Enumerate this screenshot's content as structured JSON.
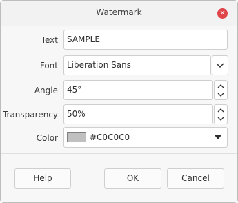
{
  "window": {
    "title": "Watermark"
  },
  "form": {
    "text": {
      "label": "Text",
      "value": "SAMPLE"
    },
    "font": {
      "label": "Font",
      "value": "Liberation Sans"
    },
    "angle": {
      "label": "Angle",
      "value": "45°"
    },
    "transparency": {
      "label": "Transparency",
      "value": "50%"
    },
    "color": {
      "label": "Color",
      "value": "#C0C0C0",
      "swatch_color": "#c0c0c0"
    }
  },
  "buttons": {
    "help": "Help",
    "ok": "OK",
    "cancel": "Cancel"
  },
  "icons": {
    "close": "close-icon",
    "font_dropdown": "chevron-down-icon",
    "spin_up": "chevron-up-icon",
    "spin_down": "chevron-down-icon",
    "color_dropdown": "caret-down-icon"
  },
  "colors": {
    "close_button": "#e0454a"
  }
}
